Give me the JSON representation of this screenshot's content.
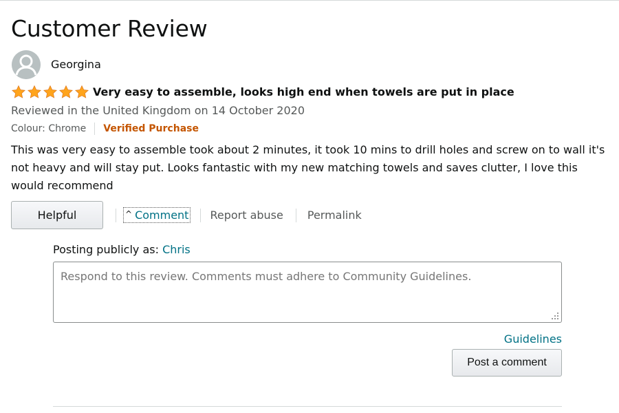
{
  "page": {
    "title": "Customer Review"
  },
  "reviewer": {
    "name": "Georgina",
    "avatar_icon": "user-avatar-icon"
  },
  "review": {
    "rating": 5,
    "rating_max": 5,
    "star_color": "#ffa41c",
    "title": "Very easy to assemble, looks high end when towels are put in place",
    "meta": "Reviewed in the United Kingdom on 14 October 2020",
    "colour": "Colour: Chrome",
    "verified": "Verified Purchase",
    "body": "This was very easy to assemble took about 2 minutes, it took 10 mins to drill holes and screw on to wall it's not heavy and will stay put. Looks fantastic with my new matching towels and saves clutter, I love this would recommend"
  },
  "actions": {
    "helpful": "Helpful",
    "comment": "Comment",
    "report": "Report abuse",
    "permalink": "Permalink"
  },
  "comment_form": {
    "posting_as_label": "Posting publicly as:",
    "posting_as_user": "Chris",
    "placeholder": "Respond to this review. Comments must adhere to Community Guidelines.",
    "value": "",
    "guidelines": "Guidelines",
    "submit": "Post a comment"
  },
  "colors": {
    "link": "#007185",
    "verified": "#c45500",
    "text": "#0f1111",
    "muted": "#565959"
  }
}
